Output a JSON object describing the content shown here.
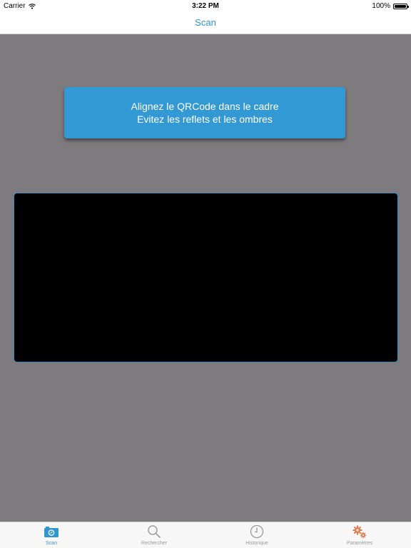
{
  "status_bar": {
    "carrier": "Carrier",
    "time": "3:22 PM",
    "battery": "100%",
    "battery_level": 1.0
  },
  "nav": {
    "title": "Scan"
  },
  "banner": {
    "line1": "Alignez le QRCode dans le cadre",
    "line2": "Evitez les reflets et les ombres"
  },
  "tabs": [
    {
      "label": "Scan",
      "icon": "camera-icon",
      "active": true
    },
    {
      "label": "Rechercher",
      "icon": "search-icon",
      "active": false
    },
    {
      "label": "Historique",
      "icon": "clock-icon",
      "active": false
    },
    {
      "label": "Paramètres",
      "icon": "gears-icon",
      "active": false
    }
  ],
  "colors": {
    "accent": "#2f96d3",
    "banner": "#3299d4",
    "background": "#7d7b7e",
    "settings_icon": "#e07a4f"
  }
}
